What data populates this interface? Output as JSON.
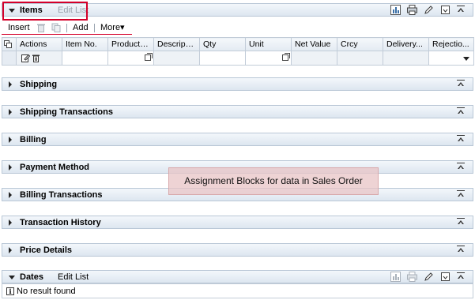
{
  "items_block": {
    "title": "Items",
    "edit_list": "Edit List",
    "header_icons": [
      "chart-icon",
      "print-icon",
      "edit-pencil-icon",
      "personalize-icon"
    ]
  },
  "toolbar": {
    "insert": "Insert",
    "add": "Add",
    "more": "More▾"
  },
  "table": {
    "headers": [
      "Actions",
      "Item No.",
      "Product ID",
      "Descripti...",
      "Qty",
      "Unit",
      "Net Value",
      "Crcy",
      "Delivery...",
      "Rejectio..."
    ]
  },
  "sections": [
    {
      "title": "Shipping"
    },
    {
      "title": "Shipping Transactions"
    },
    {
      "title": "Billing"
    },
    {
      "title": "Payment Method"
    },
    {
      "title": "Billing Transactions"
    },
    {
      "title": "Transaction History"
    },
    {
      "title": "Price Details"
    }
  ],
  "dates_block": {
    "title": "Dates",
    "edit_list": "Edit List",
    "no_result": "No result found"
  },
  "annotation": "Assignment Blocks for data in Sales Order",
  "colors": {
    "highlight_red": "#d4002a",
    "header_bg": "#dde6f0"
  }
}
